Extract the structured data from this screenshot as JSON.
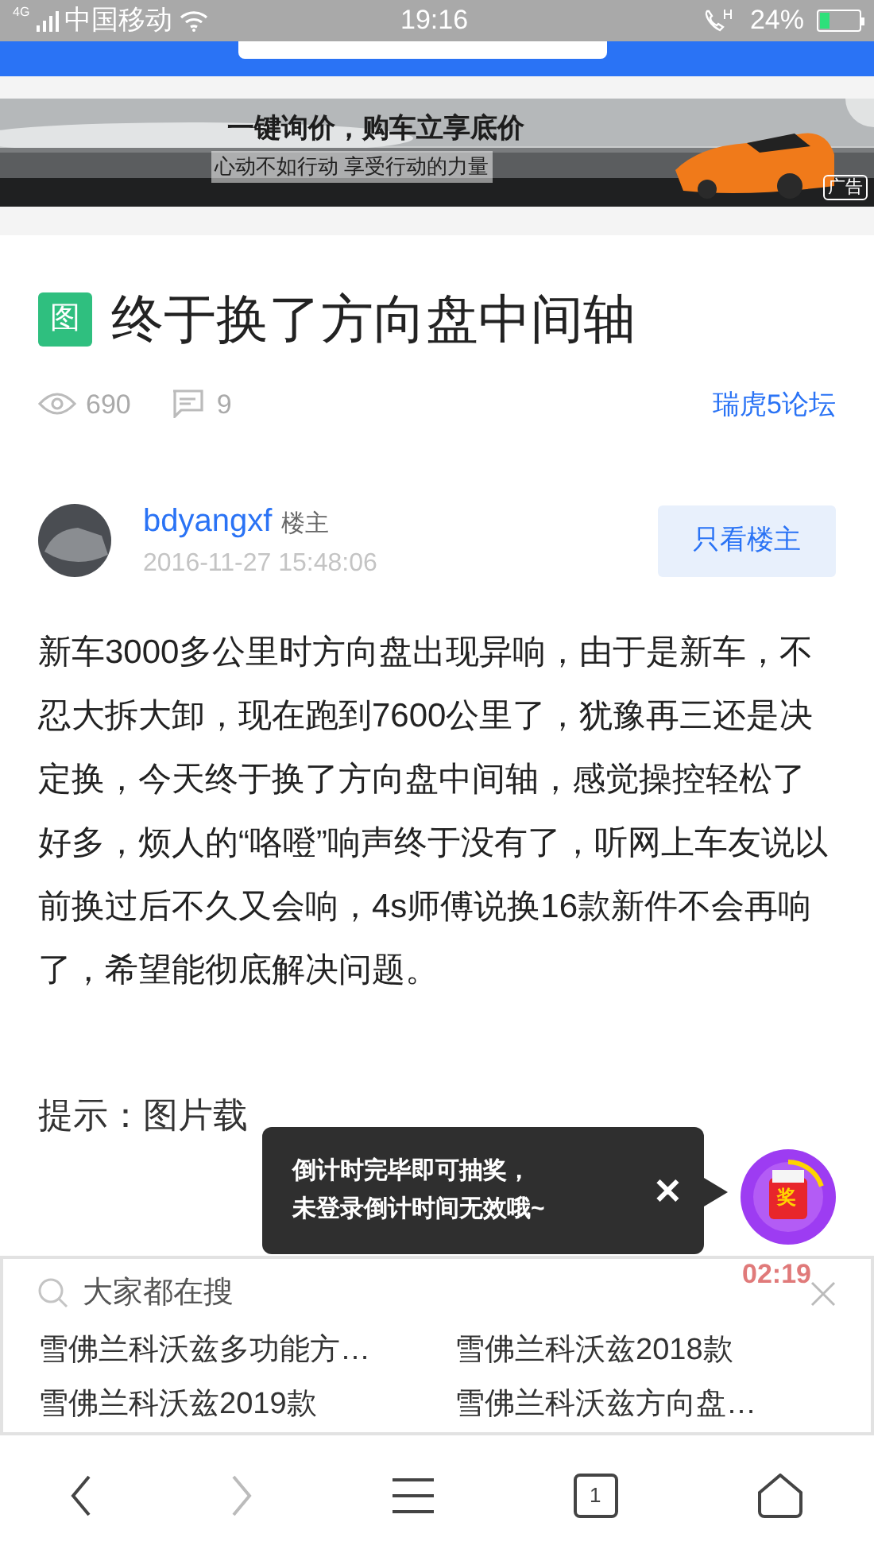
{
  "status_bar": {
    "carrier": "中国移动",
    "time": "19:16",
    "battery": "24%",
    "network": "4G"
  },
  "ad": {
    "headline": "一键询价，购车立享底价",
    "subline": "心动不如行动 享受行动的力量",
    "badge": "广告"
  },
  "post": {
    "tag": "图",
    "title": "终于换了方向盘中间轴",
    "views": "690",
    "comments": "9",
    "forum": "瑞虎5论坛"
  },
  "author": {
    "name": "bdyangxf",
    "role": "楼主",
    "time": "2016-11-27 15:48:06",
    "button": "只看楼主"
  },
  "body": "新车3000多公里时方向盘出现异响，由于是新车，不忍大拆大卸，现在跑到7600公里了，犹豫再三还是决定换，今天终于换了方向盘中间轴，感觉操控轻松了好多，烦人的“咯噔”响声终于没有了，听网上车友说以前换过后不久又会响，4s师傅说换16款新件不会再响了，希望能彻底解决问题。",
  "notice": "提示：图片载",
  "popup": {
    "lines": [
      "倒计时完毕即可抽奖，",
      "未登录倒计时间无效哦~"
    ],
    "close": "✕",
    "prize": "奖",
    "countdown": "02:19"
  },
  "hot_search": {
    "title": "大家都在搜",
    "items": [
      "雪佛兰科沃兹多功能方…",
      "雪佛兰科沃兹2018款",
      "雪佛兰科沃兹2019款",
      "雪佛兰科沃兹方向盘…"
    ]
  },
  "nav": {
    "tab_count": "1"
  }
}
